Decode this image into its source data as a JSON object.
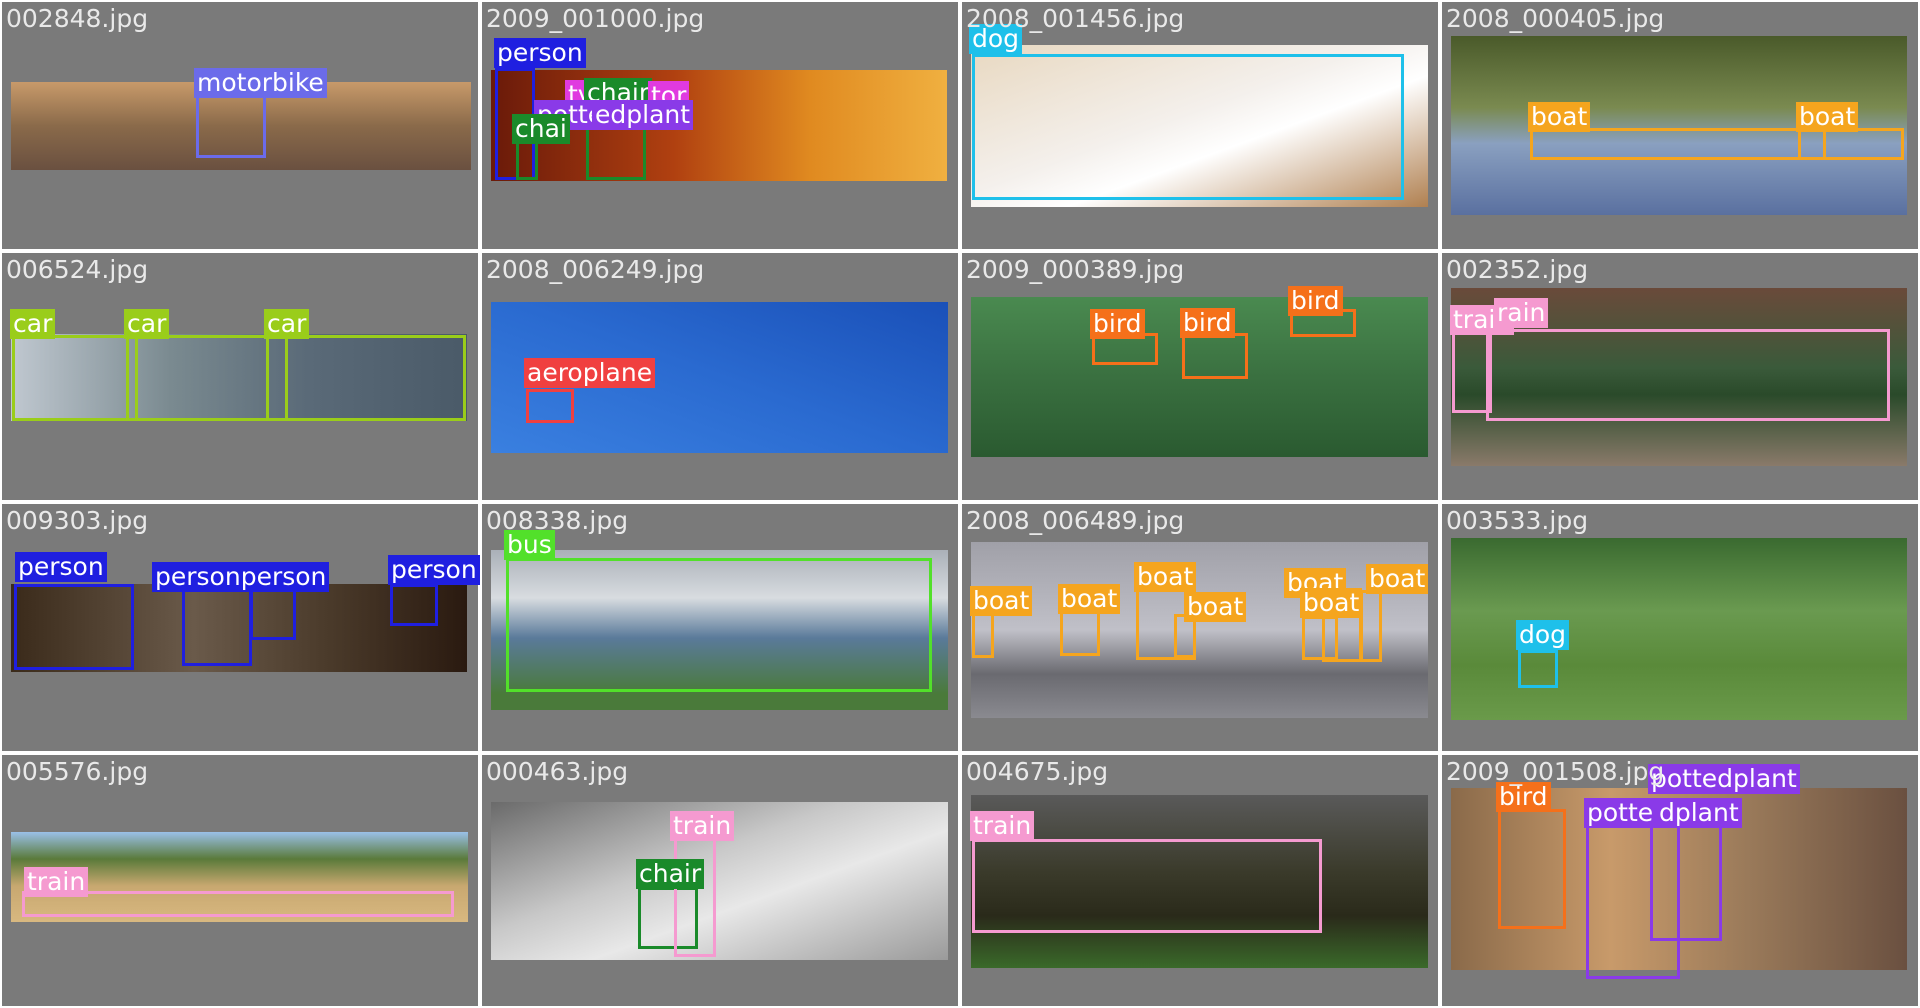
{
  "colors": {
    "tile_bg": "#7a7a7a",
    "filename_text": "#e9e9e9",
    "label_text": "#ffffff",
    "person": "#1f1fe0",
    "motorbike": "#6b6bea",
    "chair": "#1a8a2a",
    "tvmonitor": "#e03ae0",
    "pottedplant": "#8a3ae8",
    "dog": "#1ec0ea",
    "boat": "#f5a51e",
    "car": "#9acd1a",
    "aeroplane": "#f04040",
    "bird": "#f5701a",
    "train": "#f59ad0",
    "bus": "#52e02a"
  },
  "tiles": [
    {
      "filename": "002848.jpg",
      "detections": [
        {
          "label": "motorbike"
        }
      ]
    },
    {
      "filename": "2009_001000.jpg",
      "detections": [
        {
          "label": "person"
        },
        {
          "label": "tv"
        },
        {
          "label": "chair"
        },
        {
          "label": "tor"
        },
        {
          "label": "potte"
        },
        {
          "label": "edplant"
        },
        {
          "label": "chai"
        }
      ]
    },
    {
      "filename": "2008_001456.jpg",
      "detections": [
        {
          "label": "dog"
        }
      ]
    },
    {
      "filename": "2008_000405.jpg",
      "detections": [
        {
          "label": "boat"
        },
        {
          "label": "boat"
        }
      ]
    },
    {
      "filename": "006524.jpg",
      "detections": [
        {
          "label": "car"
        },
        {
          "label": "car"
        },
        {
          "label": "car"
        }
      ]
    },
    {
      "filename": "2008_006249.jpg",
      "detections": [
        {
          "label": "aeroplane"
        }
      ]
    },
    {
      "filename": "2009_000389.jpg",
      "detections": [
        {
          "label": "bird"
        },
        {
          "label": "bird"
        },
        {
          "label": "bird"
        }
      ]
    },
    {
      "filename": "002352.jpg",
      "detections": [
        {
          "label": "train"
        },
        {
          "label": "rain"
        }
      ]
    },
    {
      "filename": "009303.jpg",
      "detections": [
        {
          "label": "person"
        },
        {
          "label": "personperson"
        },
        {
          "label": "person"
        }
      ]
    },
    {
      "filename": "008338.jpg",
      "detections": [
        {
          "label": "bus"
        }
      ]
    },
    {
      "filename": "2008_006489.jpg",
      "detections": [
        {
          "label": "boat"
        },
        {
          "label": "boat"
        },
        {
          "label": "boat"
        },
        {
          "label": "boat"
        },
        {
          "label": "boat"
        },
        {
          "label": "boat"
        },
        {
          "label": "boat"
        }
      ]
    },
    {
      "filename": "003533.jpg",
      "detections": [
        {
          "label": "dog"
        }
      ]
    },
    {
      "filename": "005576.jpg",
      "detections": [
        {
          "label": "train"
        }
      ]
    },
    {
      "filename": "000463.jpg",
      "detections": [
        {
          "label": "train"
        },
        {
          "label": "chair"
        }
      ]
    },
    {
      "filename": "004675.jpg",
      "detections": [
        {
          "label": "train"
        }
      ]
    },
    {
      "filename": "2009_001508.jpg",
      "detections": [
        {
          "label": "bird"
        },
        {
          "label": "pottedplant"
        },
        {
          "label": "potte"
        },
        {
          "label": "dplant"
        }
      ]
    }
  ]
}
